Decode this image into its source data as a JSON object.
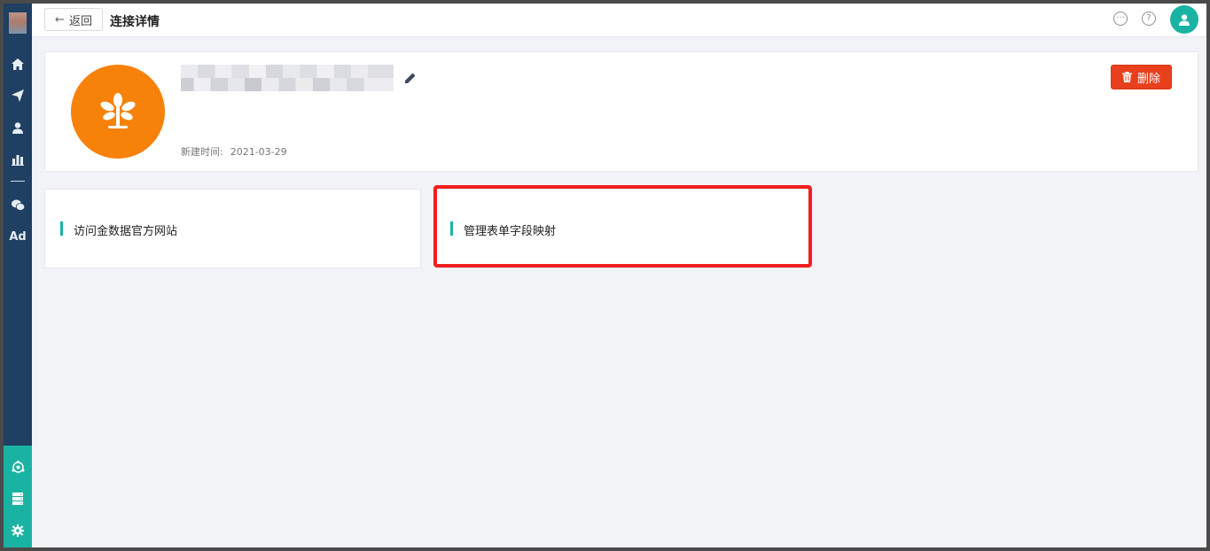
{
  "header": {
    "back_label": "返回",
    "title": "连接详情"
  },
  "sidebar": {
    "items": [
      {
        "icon": "home-icon"
      },
      {
        "icon": "send-icon"
      },
      {
        "icon": "user-icon"
      },
      {
        "icon": "bar-chart-icon"
      },
      {
        "icon": "wechat-icon"
      },
      {
        "icon": "ad-icon",
        "label": "Ad"
      }
    ],
    "bottom_items": [
      {
        "icon": "integration-icon"
      },
      {
        "icon": "server-icon"
      },
      {
        "icon": "settings-icon"
      }
    ]
  },
  "profile": {
    "created_label": "新建时间:",
    "created_date": "2021-03-29",
    "delete_label": "删除"
  },
  "cards": [
    {
      "label": "访问金数据官方网站"
    },
    {
      "label": "管理表单字段映射"
    }
  ],
  "colors": {
    "sidebar": "#1f3f63",
    "accent": "#1ab3a3",
    "avatar": "#f7820a",
    "danger": "#e8401c",
    "highlight": "#f01f1f"
  }
}
